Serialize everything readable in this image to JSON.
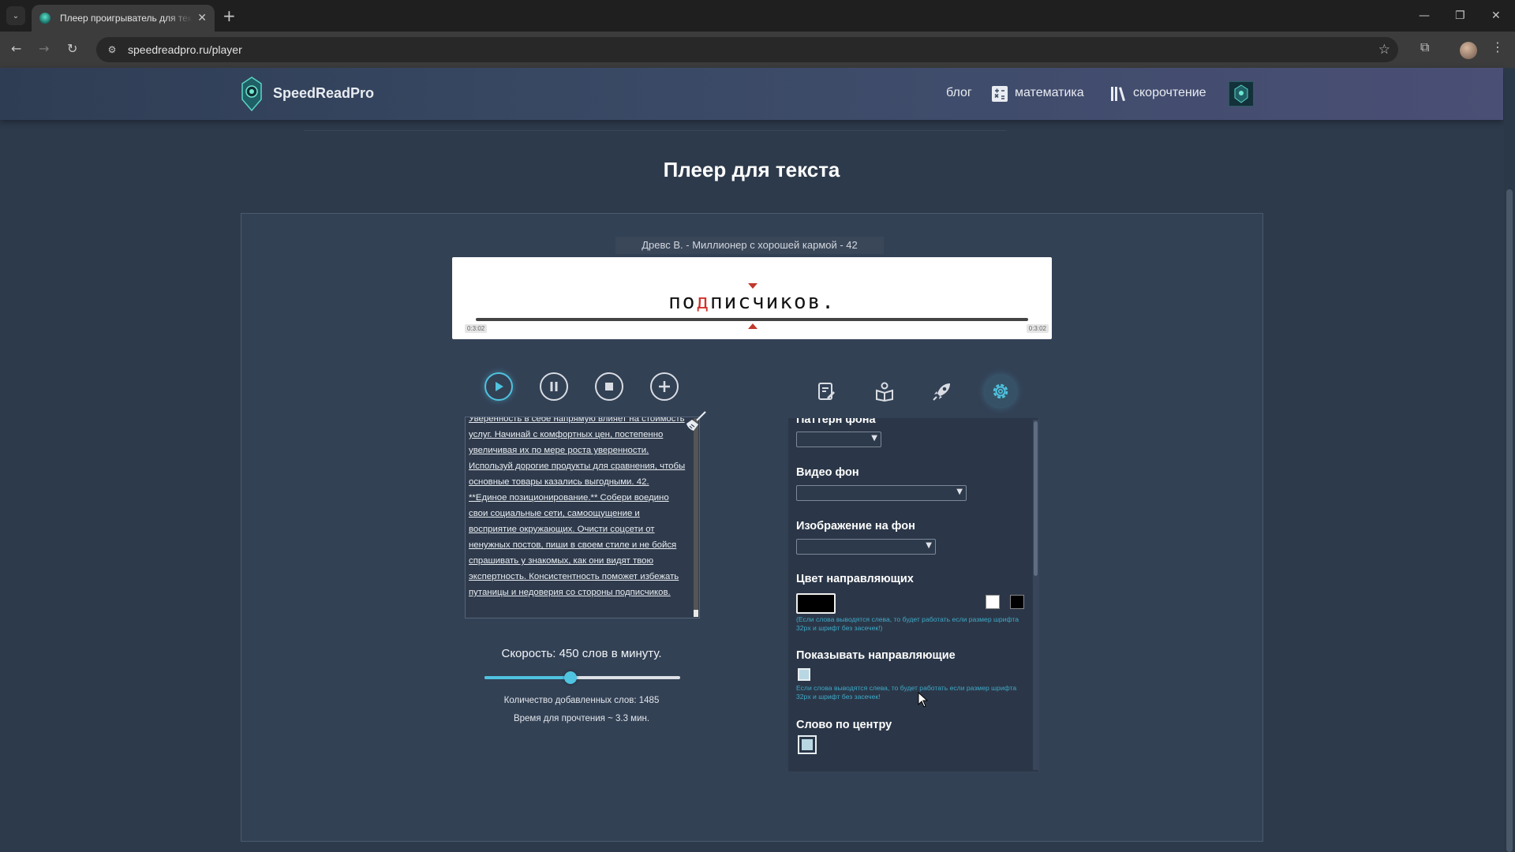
{
  "browser": {
    "tab_title": "Плеер проигрыватель для текста",
    "tab_close": "✕",
    "new_tab": "+",
    "url": "speedreadpro.ru/player",
    "win_min": "—",
    "win_restore": "❐",
    "win_close": "✕"
  },
  "header": {
    "logo_text": "SpeedReadPro",
    "nav": {
      "blog": "блог",
      "math": "математика",
      "speedreading": "скорочтение"
    }
  },
  "page": {
    "title": "Плеер для текста"
  },
  "player": {
    "book_title": "Древс В. - Миллионер с хорошей кармой - 42",
    "word_before": "по",
    "word_focus": "д",
    "word_after": "писчиков.",
    "time_start": "0:3:02",
    "time_end": "0:3:02",
    "text": "Уверенность в себе напрямую влияет на стоимость услуг. Начинай с комфортных цен, постепенно увеличивая их по мере роста уверенности. Используй дорогие продукты для сравнения, чтобы основные товары казались выгодными. 42. **Единое позиционирование.** Собери воедино свои социальные сети, самоощущение и восприятие окружающих. Очисти соцсети от ненужных постов, пиши в своем стиле и не бойся спрашивать у знакомых, как они видят твою экспертность. Консистентность поможет избежать путаницы и недоверия со стороны подписчиков.",
    "speed_label": "Скорость: 450 слов в минуту.",
    "speed_fraction": 0.44,
    "words_added": "Количество добавленных слов: 1485",
    "read_time": "Время для прочтения ~ 3.3 мин."
  },
  "settings": {
    "bg_pattern_label": "Паттерн фона",
    "video_bg_label": "Видео фон",
    "image_bg_label": "Изображение на фон",
    "guide_color_label": "Цвет направляющих",
    "guide_color": "#000000",
    "guide_hint": "(Если слова выводятся слева, то будет работать если размер шрифта 32px и шрифт без засечек!)",
    "show_guides_label": "Показывать направляющие",
    "show_guides_hint": "Если слова выводятся слева, то будет работать если размер шрифта 32px и шрифт без засечек!",
    "center_word_label": "Слово по центру"
  },
  "colors": {
    "accent": "#4fc3e0",
    "focus_letter": "#d0312d",
    "panel_bg": "#334155"
  }
}
